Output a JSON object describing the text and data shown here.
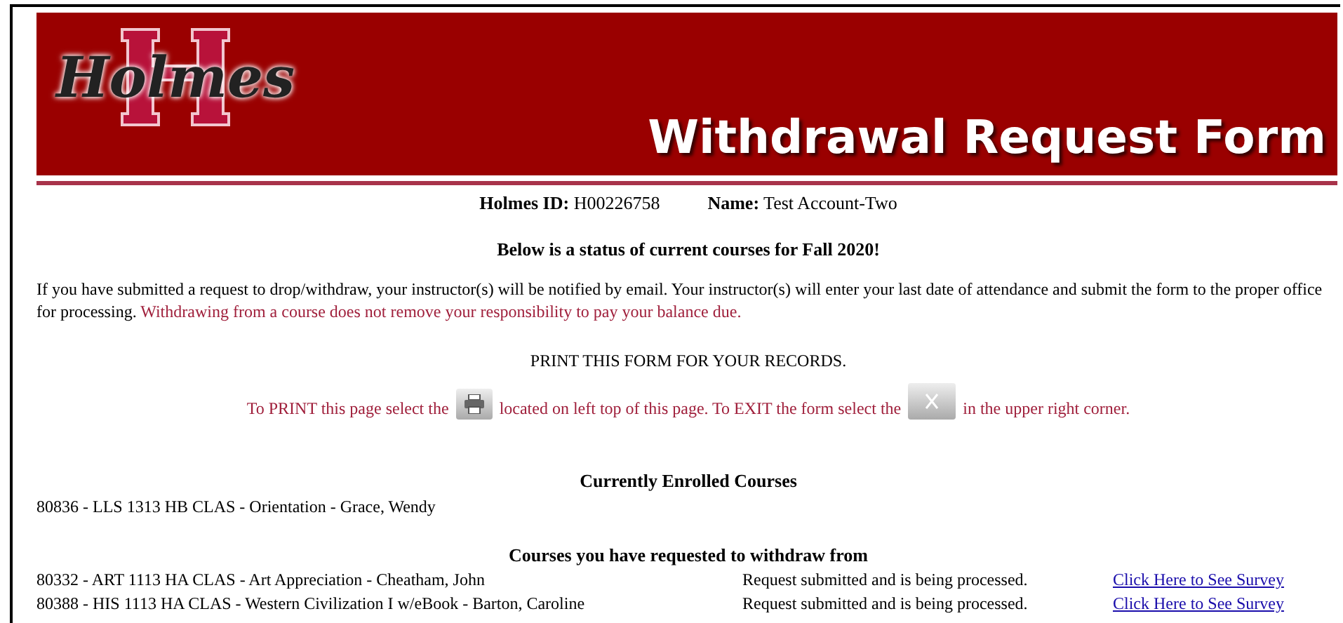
{
  "banner": {
    "logo": "Holmes",
    "title": "Withdrawal Request Form"
  },
  "student": {
    "id_label": "Holmes ID:",
    "id": "H00226758",
    "name_label": "Name:",
    "name": "Test Account-Two"
  },
  "status_heading": "Below is a status of current courses for Fall 2020!",
  "notice": {
    "text": "If you have submitted a request to drop/withdraw, your instructor(s) will be notified by email. Your instructor(s) will enter your last date of attendance and submit the form to the proper office for processing.",
    "warning": "Withdrawing from a course does not remove your responsibility to pay your balance due."
  },
  "print_notice": "PRINT THIS FORM FOR YOUR RECORDS.",
  "instructions": {
    "part_1": "To PRINT this page select the",
    "part_2": "located on left top of this page. To EXIT the form select the",
    "part_3": "in the upper right corner."
  },
  "enrolled": {
    "heading": "Currently Enrolled Courses",
    "courses": [
      "80836 - LLS 1313 HB CLAS - Orientation - Grace, Wendy"
    ]
  },
  "withdrawn": {
    "heading": "Courses you have requested to withdraw from",
    "courses": [
      {
        "course": "80332 - ART 1113 HA CLAS - Art Appreciation - Cheatham, John",
        "status": "Request submitted and is being processed.",
        "link": "Click Here to See Survey"
      },
      {
        "course": "80388 - HIS 1113 HA CLAS - Western Civilization I w/eBook - Barton, Caroline",
        "status": "Request submitted and is being processed.",
        "link": "Click Here to See Survey"
      }
    ]
  }
}
